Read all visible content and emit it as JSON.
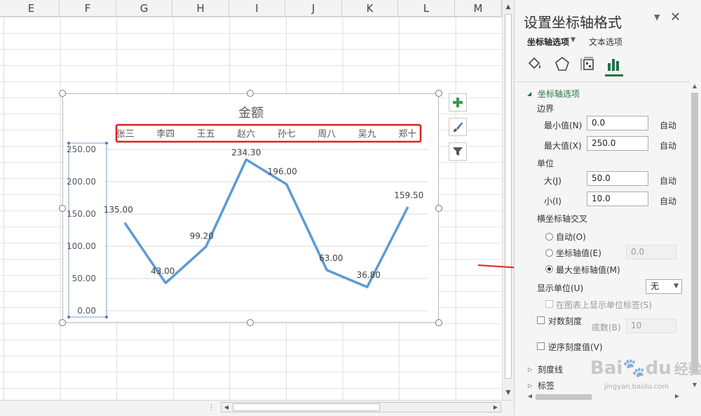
{
  "sheet": {
    "columns": [
      "E",
      "F",
      "G",
      "H",
      "I",
      "J",
      "K",
      "L",
      "M"
    ]
  },
  "chart_data": {
    "type": "line",
    "title": "金额",
    "categories": [
      "张三",
      "李四",
      "王五",
      "赵六",
      "孙七",
      "周八",
      "吴九",
      "郑十"
    ],
    "series": [
      {
        "values": [
          135.0,
          43.0,
          99.2,
          234.3,
          196.0,
          63.0,
          36.8,
          159.5
        ],
        "labels": [
          "135.00",
          "43.00",
          "99.20",
          "234.30",
          "196.00",
          "63.00",
          "36.80",
          "159.50"
        ]
      }
    ],
    "y_ticks": [
      "0.00",
      "50.00",
      "100.00",
      "150.00",
      "200.00",
      "250.00"
    ],
    "ylim": [
      0,
      250
    ],
    "x_axis_position": "top",
    "grid": true,
    "line_color": "#5b9bd5",
    "highlight_color": "#e02020"
  },
  "chart_buttons": {
    "add": "plus-icon",
    "style": "brush-icon",
    "filter": "filter-icon"
  },
  "pane": {
    "title": "设置坐标轴格式",
    "tab_axis_options": "坐标轴选项",
    "tab_text_options": "文本选项",
    "section_axis_options": "坐标轴选项",
    "bounds_heading": "边界",
    "min_label": "最小值(N)",
    "min_value": "0.0",
    "min_auto": "自动",
    "max_label": "最大值(X)",
    "max_value": "250.0",
    "max_auto": "自动",
    "units_heading": "单位",
    "major_label": "大(J)",
    "major_value": "50.0",
    "major_auto": "自动",
    "minor_label": "小(I)",
    "minor_value": "10.0",
    "minor_auto": "自动",
    "cross_heading": "横坐标轴交叉",
    "cross_auto": "自动(O)",
    "cross_value_label": "坐标轴值(E)",
    "cross_value": "0.0",
    "cross_max": "最大坐标轴值(M)",
    "display_units_label": "显示单位(U)",
    "display_units_value": "无",
    "show_units_label": "在图表上显示单位标签(S)",
    "log_scale_label": "对数刻度",
    "base_label": "底数(B)",
    "base_value": "10",
    "reverse_label": "逆序刻度值(V)",
    "tickmarks_label": "刻度线",
    "labels_label": "标签",
    "accent_color": "#217346"
  },
  "watermark": {
    "brand": "Bai",
    "brand2": "du",
    "suffix": "经验",
    "url": "jingyan.baidu.com"
  }
}
